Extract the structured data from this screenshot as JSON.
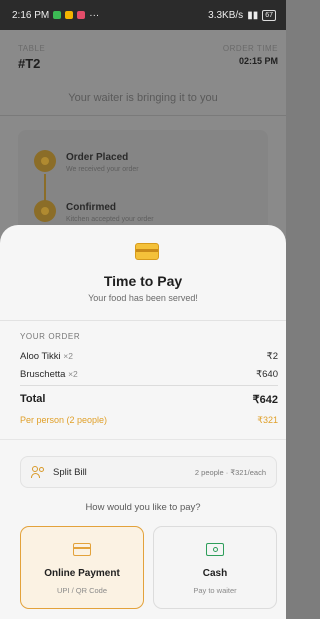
{
  "status_bar": {
    "time": "2:16 PM",
    "more": "···",
    "network_speed": "3.3KB/s",
    "battery": "67"
  },
  "background": {
    "table_label": "TABLE",
    "table_value": "#T2",
    "order_time_label": "ORDER TIME",
    "order_time_value": "02:15 PM",
    "waiter_message": "Your waiter is bringing it to you",
    "steps": [
      {
        "title": "Order Placed",
        "subtitle": "We received your order"
      },
      {
        "title": "Confirmed",
        "subtitle": "Kitchen accepted your order"
      }
    ]
  },
  "sheet": {
    "title": "Time to Pay",
    "subtitle": "Your food has been served!",
    "order_label": "YOUR ORDER",
    "items": [
      {
        "name": "Aloo Tikki",
        "qty": "×2",
        "price": "₹2"
      },
      {
        "name": "Bruschetta",
        "qty": "×2",
        "price": "₹640"
      }
    ],
    "total_label": "Total",
    "total_value": "₹642",
    "per_person_label": "Per person (2 people)",
    "per_person_value": "₹321",
    "split_label": "Split Bill",
    "split_info": "2 people · ₹321/each",
    "pay_question": "How would you like to pay?",
    "payment_options": [
      {
        "title": "Online Payment",
        "subtitle": "UPI / QR Code",
        "icon": "card-icon",
        "selected": true
      },
      {
        "title": "Cash",
        "subtitle": "Pay to waiter",
        "icon": "cash-icon",
        "selected": false
      }
    ]
  },
  "colors": {
    "accent": "#e3a23b",
    "cash_green": "#2e9e5a",
    "overlay": "#8a8a8a"
  }
}
